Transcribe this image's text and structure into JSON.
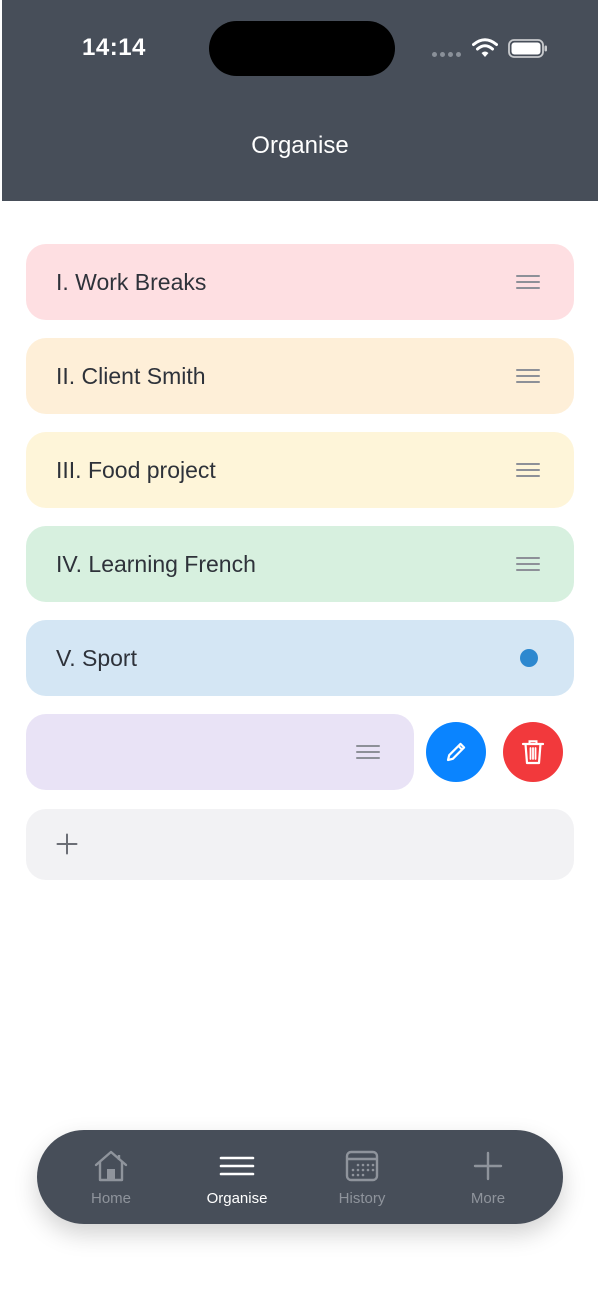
{
  "status": {
    "time": "14:14"
  },
  "header": {
    "title": "Organise"
  },
  "colors": {
    "header": "#474e59",
    "accent_blue": "#0a84ff",
    "danger_red": "#f2393c",
    "tab_active": "#ffffff",
    "tab_inactive": "#8f949c"
  },
  "categories": [
    {
      "label": "I. Work Breaks",
      "bg": "#fedfe2",
      "control": "drag-handle-icon"
    },
    {
      "label": "II. Client Smith",
      "bg": "#feefd8",
      "control": "drag-handle-icon"
    },
    {
      "label": "III. Food project",
      "bg": "#fef5d9",
      "control": "drag-handle-icon"
    },
    {
      "label": "IV. Learning French",
      "bg": "#d7f0df",
      "control": "drag-handle-icon"
    },
    {
      "label": "V. Sport",
      "bg": "#d4e6f4",
      "control": "color-dot"
    },
    {
      "label": "",
      "bg": "#e9e3f6",
      "control": "drag-handle-icon",
      "swiped_actions": [
        "edit-icon",
        "trash-icon"
      ]
    }
  ],
  "add_row": {
    "bg": "#f2f2f4",
    "icon": "plus-icon"
  },
  "tabbar": {
    "tabs": [
      {
        "label": "Home",
        "icon": "home-icon",
        "active": false
      },
      {
        "label": "Organise",
        "icon": "menu-icon",
        "active": true
      },
      {
        "label": "History",
        "icon": "calendar-icon",
        "active": false
      },
      {
        "label": "More",
        "icon": "plus-icon",
        "active": false
      }
    ]
  }
}
